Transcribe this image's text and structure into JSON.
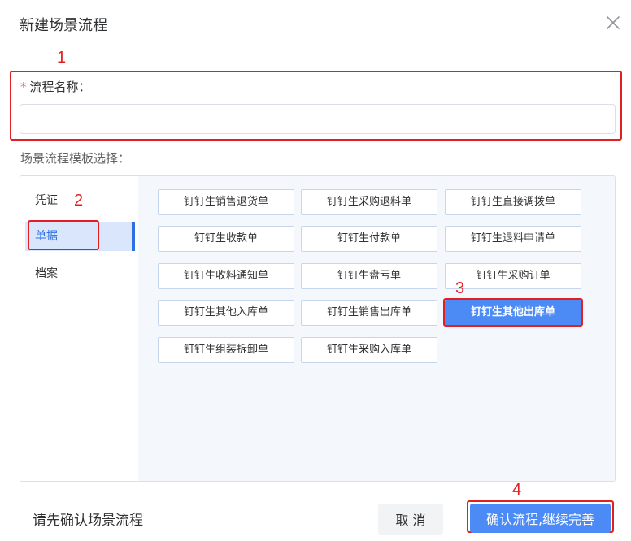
{
  "dialog": {
    "title": "新建场景流程"
  },
  "form": {
    "required_mark": "*",
    "name_label": "流程名称：",
    "name_value": "",
    "name_placeholder": "",
    "template_label": "场景流程模板选择："
  },
  "nav": {
    "items": [
      {
        "label": "凭证"
      },
      {
        "label": "单据"
      },
      {
        "label": "档案"
      }
    ],
    "active": "单据"
  },
  "templates": [
    {
      "label": "钉钉生销售退货单"
    },
    {
      "label": "钉钉生采购退料单"
    },
    {
      "label": "钉钉生直接调拨单"
    },
    {
      "label": "钉钉生收款单"
    },
    {
      "label": "钉钉生付款单"
    },
    {
      "label": "钉钉生退料申请单"
    },
    {
      "label": "钉钉生收料通知单"
    },
    {
      "label": "钉钉生盘亏单"
    },
    {
      "label": "钉钉生采购订单"
    },
    {
      "label": "钉钉生其他入库单"
    },
    {
      "label": "钉钉生销售出库单"
    },
    {
      "label": "钉钉生其他出库单"
    },
    {
      "label": "钉钉生组装拆卸单"
    },
    {
      "label": "钉钉生采购入库单"
    }
  ],
  "selected_template": "钉钉生其他出库单",
  "footer": {
    "hint": "请先确认场景流程",
    "cancel_label": "取 消",
    "confirm_label": "确认流程,继续完善"
  },
  "annotations": [
    "1",
    "2",
    "3",
    "4"
  ],
  "colors": {
    "primary": "#4c8bf5",
    "annotation": "#e02020",
    "required": "#f56c6c"
  },
  "icons": {
    "close": "close-icon"
  }
}
